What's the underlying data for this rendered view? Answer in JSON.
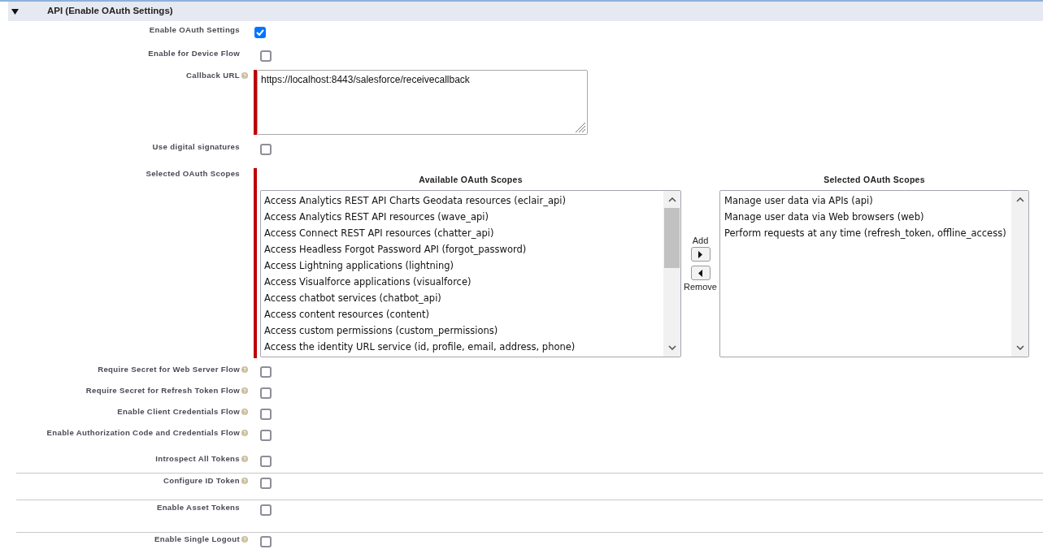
{
  "section": {
    "title": "API (Enable OAuth Settings)",
    "expanded": true
  },
  "field_groups": [
    {
      "fields": [
        {
          "kind": "checkbox",
          "label": "Enable OAuth Settings",
          "help": false,
          "required": false,
          "checked": true
        },
        {
          "kind": "checkbox",
          "label": "Enable for Device Flow",
          "help": false,
          "required": false,
          "checked": false
        },
        {
          "kind": "textarea",
          "label": "Callback URL",
          "help": true,
          "required": true,
          "value": "https://localhost:8443/salesforce/receivecallback"
        },
        {
          "kind": "checkbox",
          "label": "Use digital signatures",
          "help": false,
          "required": false,
          "checked": false
        },
        {
          "kind": "scopes",
          "label": "Selected OAuth Scopes",
          "help": false,
          "required": true,
          "available_list": {
            "heading": "Available OAuth Scopes",
            "options": [
              {
                "label": "Access Analytics REST API Charts Geodata resources (eclair_api)",
                "selected": false
              },
              {
                "label": "Access Analytics REST API resources (wave_api)",
                "selected": false
              },
              {
                "label": "Access Connect REST API resources (chatter_api)",
                "selected": false
              },
              {
                "label": "Access Headless Forgot Password API (forgot_password)",
                "selected": false
              },
              {
                "label": "Access Lightning applications (lightning)",
                "selected": false
              },
              {
                "label": "Access Visualforce applications (visualforce)",
                "selected": false
              },
              {
                "label": "Access chatbot services (chatbot_api)",
                "selected": false
              },
              {
                "label": "Access content resources (content)",
                "selected": false
              },
              {
                "label": "Access custom permissions (custom_permissions)",
                "selected": false
              },
              {
                "label": "Access the identity URL service (id, profile, email, address, phone)",
                "selected": false
              }
            ]
          },
          "add_label": "Add",
          "remove_label": "Remove",
          "selected_list": {
            "heading": "Selected OAuth Scopes",
            "options": [
              {
                "label": "Manage user data via APIs (api)",
                "selected": false
              },
              {
                "label": "Manage user data via Web browsers (web)",
                "selected": false
              },
              {
                "label": "Perform requests at any time (refresh_token, offline_access)",
                "selected": false
              }
            ]
          }
        },
        {
          "kind": "checkbox",
          "label": "Require Secret for Web Server Flow",
          "help": true,
          "required": false,
          "checked": false
        },
        {
          "kind": "checkbox",
          "label": "Require Secret for Refresh Token Flow",
          "help": true,
          "required": false,
          "checked": false
        },
        {
          "kind": "checkbox",
          "label": "Enable Client Credentials Flow",
          "help": true,
          "required": false,
          "checked": false
        },
        {
          "kind": "checkbox",
          "label": "Enable Authorization Code and Credentials Flow",
          "help": true,
          "required": false,
          "checked": false
        },
        {
          "kind": "checkbox",
          "label": "Introspect All Tokens",
          "help": true,
          "required": false,
          "checked": false
        }
      ]
    },
    {
      "fields": [
        {
          "kind": "checkbox",
          "label": "Configure ID Token",
          "help": true,
          "required": false,
          "checked": false
        }
      ]
    },
    {
      "fields": [
        {
          "kind": "checkbox",
          "label": "Enable Asset Tokens",
          "help": false,
          "required": false,
          "checked": false
        }
      ]
    },
    {
      "fields": [
        {
          "kind": "checkbox",
          "label": "Enable Single Logout",
          "help": true,
          "required": false,
          "checked": false
        }
      ]
    }
  ]
}
